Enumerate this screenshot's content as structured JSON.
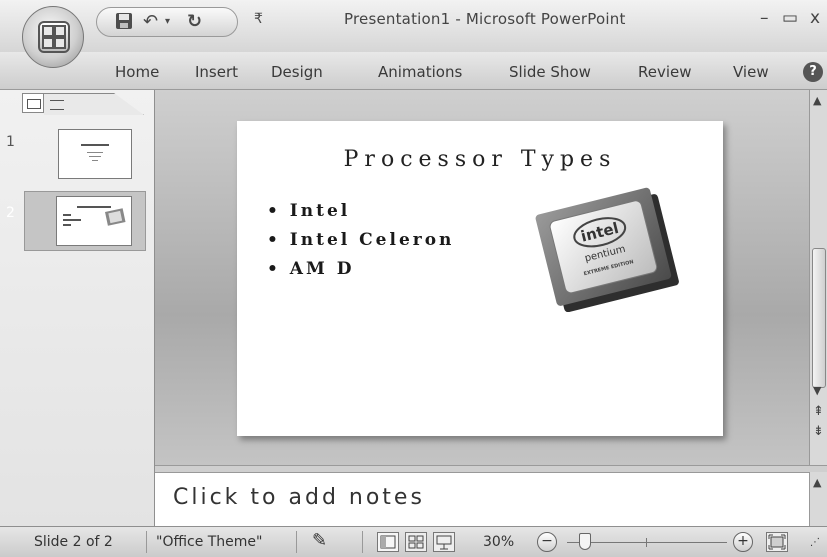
{
  "app": {
    "window_title": "Presentation1 - Microsoft PowerPoint"
  },
  "quick_access": {
    "save_icon": "save-icon",
    "undo_icon": "undo-icon",
    "redo_icon": "redo-icon",
    "customize_icon": "customize-qat-icon"
  },
  "window_controls": {
    "minimize": "–",
    "maximize": "▭",
    "close": "x"
  },
  "ribbon": {
    "tabs": [
      {
        "label": "Home"
      },
      {
        "label": "Insert"
      },
      {
        "label": "Design"
      },
      {
        "label": "Animations"
      },
      {
        "label": "Slide Show"
      },
      {
        "label": "Review"
      },
      {
        "label": "View"
      }
    ],
    "help": "?"
  },
  "slides_panel": {
    "thumbnails": [
      {
        "number": "1"
      },
      {
        "number": "2"
      }
    ]
  },
  "slide": {
    "title": "Processor Types",
    "bullets": [
      "• Intel",
      "• Intel Celeron",
      "• AM D"
    ],
    "image_logo": {
      "brand": "intel",
      "model": "pentium",
      "edition": "EXTREME EDITION"
    }
  },
  "notes": {
    "placeholder": "Click to add notes"
  },
  "status_bar": {
    "slide_position": "Slide 2 of 2",
    "theme": "\"Office Theme\"",
    "zoom": "30%",
    "zoom_level": 0.3
  }
}
